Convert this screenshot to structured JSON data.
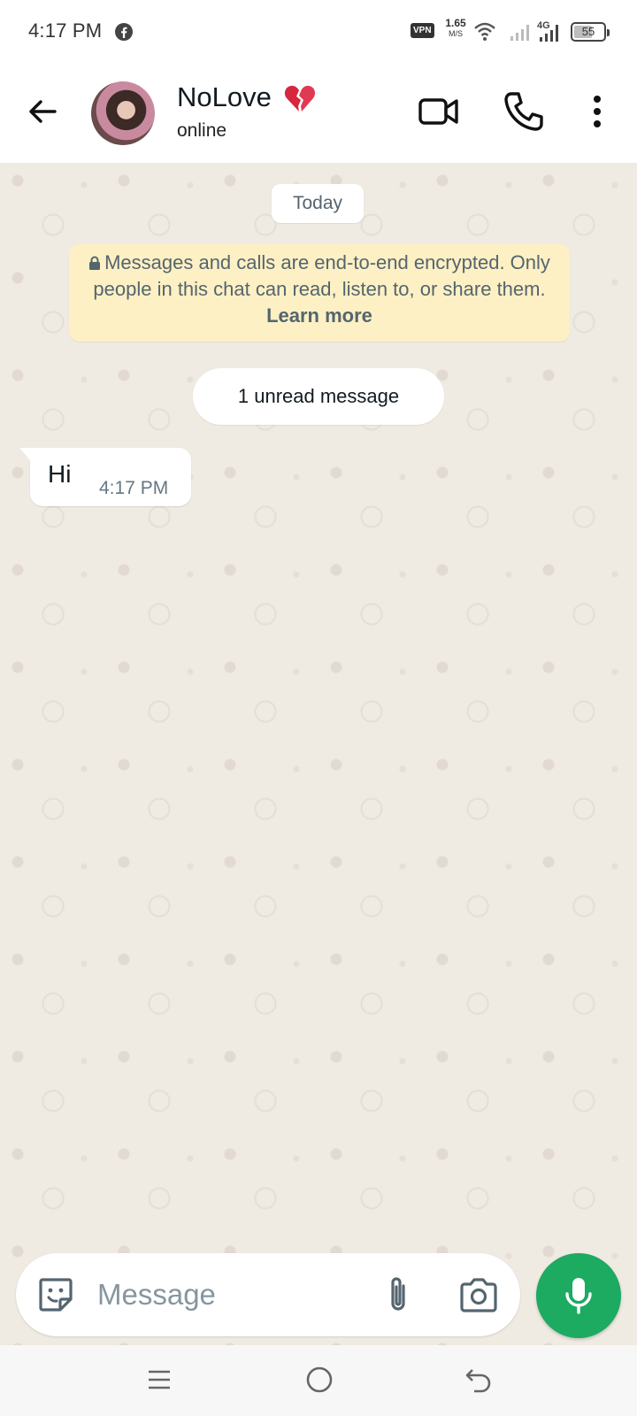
{
  "status_bar": {
    "time": "4:17 PM",
    "vpn": "VPN",
    "speed_value": "1.65",
    "speed_unit": "M/S",
    "network": "4G",
    "battery": "55"
  },
  "header": {
    "contact_name": "NoLove",
    "contact_status": "online"
  },
  "chat": {
    "date_label": "Today",
    "encryption_text": "Messages and calls are end-to-end encrypted. Only people in this chat can read, listen to, or share them. ",
    "encryption_link": "Learn more",
    "unread_label": "1 unread message",
    "messages": [
      {
        "text": "Hi",
        "time": "4:17 PM",
        "direction": "incoming"
      }
    ]
  },
  "composer": {
    "placeholder": "Message"
  },
  "colors": {
    "accent": "#1daa61",
    "chat_background": "#efeae2",
    "notice_background": "#fdf0c4"
  },
  "icons": {
    "back": "arrow-left-icon",
    "video": "video-camera-icon",
    "call": "phone-icon",
    "more": "dots-vertical-icon",
    "emoji": "sticker-icon",
    "attach": "paperclip-icon",
    "camera": "camera-icon",
    "mic": "microphone-icon",
    "heart": "broken-heart-icon"
  }
}
